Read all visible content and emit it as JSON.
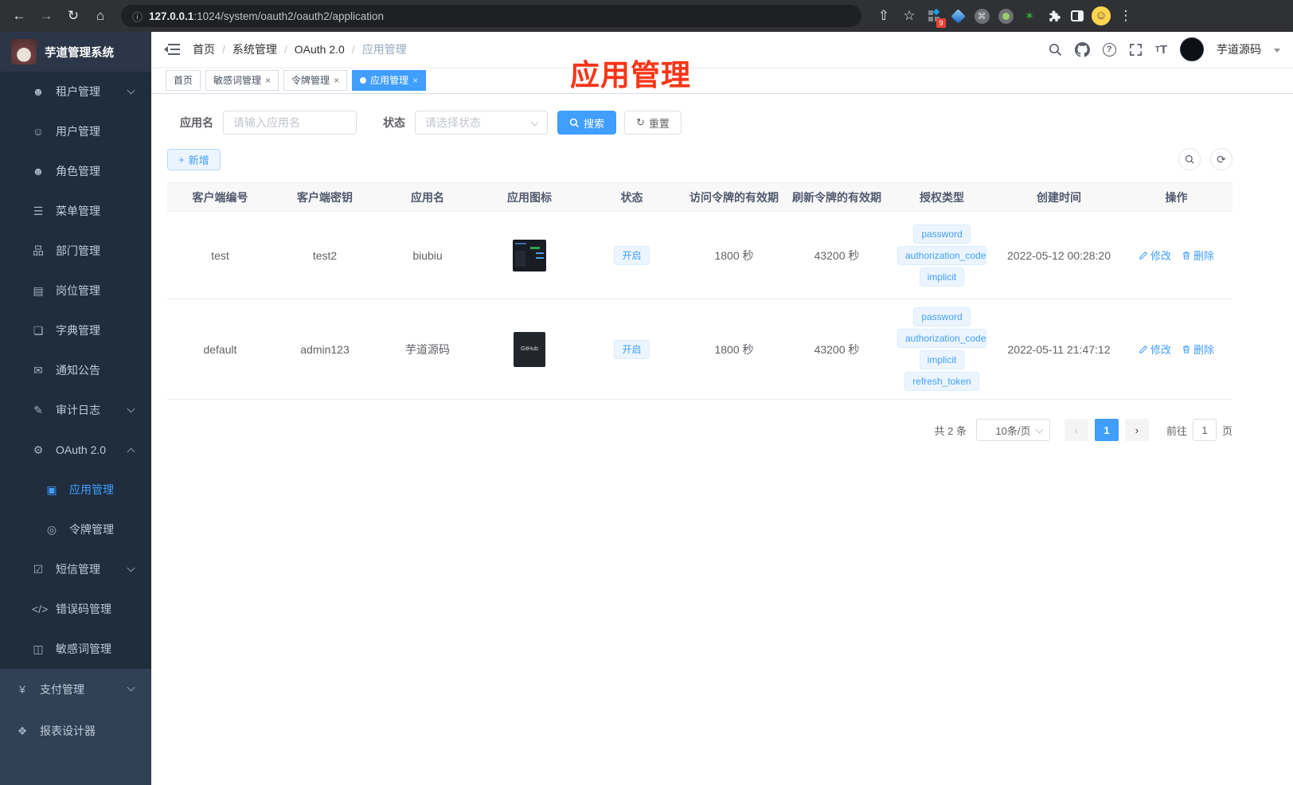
{
  "browser": {
    "url_host": "127.0.0.1",
    "url_path": ":1024/system/oauth2/oauth2/application",
    "extension_badge": "9",
    "icons": {
      "back": "←",
      "forward": "→",
      "reload": "↻",
      "home": "⌂",
      "info": "ⓘ",
      "share": "⇧",
      "bookmark": "☆",
      "menu": "⋮",
      "cmd": "⌘",
      "green_star": "✶"
    }
  },
  "logo": {
    "title": "芋道管理系统"
  },
  "sidebar": {
    "items": [
      {
        "icon_name": "tenant-users-icon",
        "glyph": "☻",
        "label": "租户管理",
        "chevron": "down",
        "level": "sub"
      },
      {
        "icon_name": "user-icon",
        "glyph": "☺",
        "label": "用户管理",
        "level": "sub"
      },
      {
        "icon_name": "role-users-icon",
        "glyph": "☻",
        "label": "角色管理",
        "level": "sub"
      },
      {
        "icon_name": "menu-tree-icon",
        "glyph": "☰",
        "label": "菜单管理",
        "level": "sub"
      },
      {
        "icon_name": "dept-org-icon",
        "glyph": "品",
        "label": "部门管理",
        "level": "sub"
      },
      {
        "icon_name": "post-badge-icon",
        "glyph": "▤",
        "label": "岗位管理",
        "level": "sub"
      },
      {
        "icon_name": "dict-book-icon",
        "glyph": "❏",
        "label": "字典管理",
        "level": "sub"
      },
      {
        "icon_name": "notice-message-icon",
        "glyph": "✉",
        "label": "通知公告",
        "level": "sub"
      },
      {
        "icon_name": "audit-log-icon",
        "glyph": "✎",
        "label": "审计日志",
        "chevron": "down",
        "level": "sub"
      },
      {
        "icon_name": "oauth-robot-icon",
        "glyph": "⚙",
        "label": "OAuth 2.0",
        "chevron": "up",
        "level": "sub"
      },
      {
        "icon_name": "app-briefcase-icon",
        "glyph": "▣",
        "label": "应用管理",
        "level": "child",
        "active": true
      },
      {
        "icon_name": "token-icon",
        "glyph": "◎",
        "label": "令牌管理",
        "level": "child"
      },
      {
        "icon_name": "sms-shield-icon",
        "glyph": "☑",
        "label": "短信管理",
        "chevron": "down",
        "level": "sub"
      },
      {
        "icon_name": "errcode-icon",
        "glyph": "</>",
        "label": "错误码管理",
        "level": "sub"
      },
      {
        "icon_name": "sensitive-word-icon",
        "glyph": "◫",
        "label": "敏感词管理",
        "level": "sub"
      },
      {
        "icon_name": "pay-yen-icon",
        "glyph": "¥",
        "label": "支付管理",
        "chevron": "down",
        "level": "top"
      },
      {
        "icon_name": "report-designer-icon",
        "glyph": "❖",
        "label": "报表设计器",
        "level": "top"
      }
    ]
  },
  "header": {
    "breadcrumb": [
      "首页",
      "系统管理",
      "OAuth 2.0",
      "应用管理"
    ],
    "user_name": "芋道源码"
  },
  "tabs": [
    {
      "label": "首页",
      "closable": false,
      "active": false
    },
    {
      "label": "敏感词管理",
      "closable": true,
      "active": false
    },
    {
      "label": "令牌管理",
      "closable": true,
      "active": false
    },
    {
      "label": "应用管理",
      "closable": true,
      "active": true
    }
  ],
  "annotation": {
    "text": "应用管理"
  },
  "filters": {
    "name_label": "应用名",
    "name_placeholder": "请输入应用名",
    "status_label": "状态",
    "status_placeholder": "请选择状态",
    "search_label": "搜索",
    "reset_label": "重置",
    "add_label": "新增"
  },
  "table": {
    "columns": [
      "客户端编号",
      "客户端密钥",
      "应用名",
      "应用图标",
      "状态",
      "访问令牌的有效期",
      "刷新令牌的有效期",
      "授权类型",
      "创建时间",
      "操作"
    ],
    "rows": [
      {
        "client_id": "test",
        "secret": "test2",
        "name": "biubiu",
        "icon_type": "dashboard",
        "icon_text": "",
        "status": "开启",
        "access_ttl": "1800 秒",
        "refresh_ttl": "43200 秒",
        "grants": [
          "password",
          "authorization_code",
          "implicit"
        ],
        "created": "2022-05-12 00:28:20"
      },
      {
        "client_id": "default",
        "secret": "admin123",
        "name": "芋道源码",
        "icon_type": "github",
        "icon_text": "GitHub",
        "status": "开启",
        "access_ttl": "1800 秒",
        "refresh_ttl": "43200 秒",
        "grants": [
          "password",
          "authorization_code",
          "implicit",
          "refresh_token"
        ],
        "created": "2022-05-11 21:47:12"
      }
    ],
    "actions": {
      "edit": "修改",
      "delete": "删除"
    }
  },
  "pagination": {
    "total": "共 2 条",
    "page_size": "10条/页",
    "current_page": "1",
    "goto_prefix": "前往",
    "goto_value": "1",
    "goto_suffix": "页"
  }
}
